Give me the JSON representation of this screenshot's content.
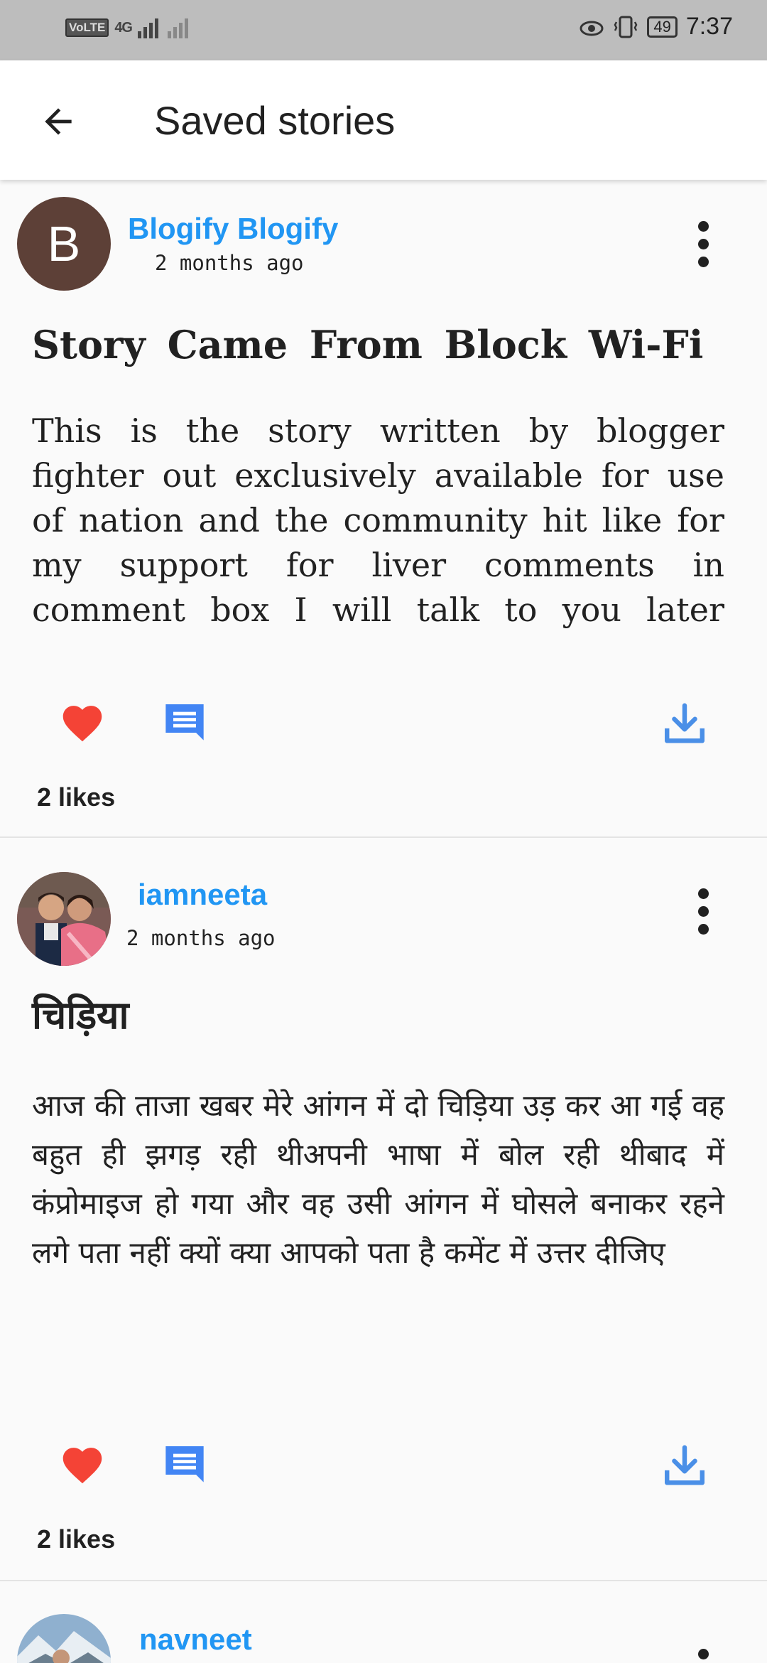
{
  "status_bar": {
    "volte": "VoLTE",
    "network": "4G",
    "battery": "49",
    "time": "7:37"
  },
  "app_bar": {
    "title": "Saved stories",
    "back_icon": "arrow-back-icon"
  },
  "stories": [
    {
      "avatar_letter": "B",
      "avatar_color": "#5d4037",
      "author": "Blogify Blogify",
      "time_ago": "2 months ago",
      "title": "Story Came From Block Wi-Fi",
      "body": "This is the story written by blogger fighter out exclusively available for use of nation and the community hit like for my support for liver comments in comment box I will talk to you later",
      "likes": "2 likes"
    },
    {
      "avatar_type": "photo",
      "author": "iamneeta",
      "time_ago": "2 months ago",
      "title": "चिड़िया",
      "body": "आज की ताजा खबर मेरे आंगन में दो चिड़िया उड़ कर आ गई वह बहुत ही झगड़ रही थीअपनी भाषा में बोल रही थीबाद में कंप्रोमाइज हो गया और वह उसी आंगन में घोसले बनाकर रहने लगे पता नहीं क्यों क्या आपको पता है कमेंट में उत्तर दीजिए",
      "likes": "2 likes"
    },
    {
      "avatar_type": "photo",
      "author": "navneet"
    }
  ],
  "colors": {
    "accent": "#2196f3",
    "like": "#f44336",
    "comment": "#4285f4",
    "download": "#4a8fe7"
  }
}
